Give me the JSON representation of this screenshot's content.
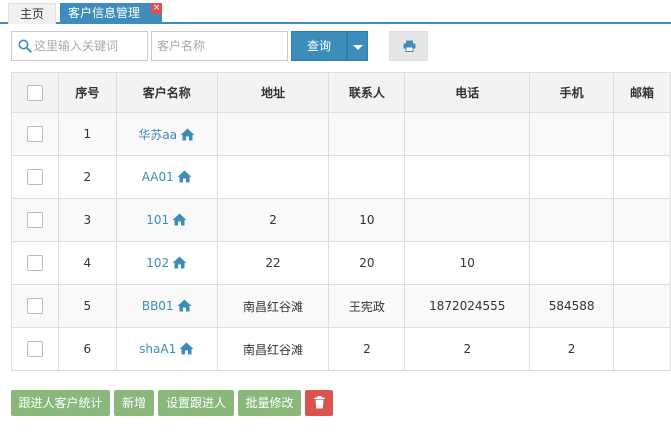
{
  "tabs": {
    "home": "主页",
    "active": "客户信息管理",
    "close": "×"
  },
  "toolbar": {
    "keyword_placeholder": "这里输入关键词",
    "name_placeholder": "客户名称",
    "query_label": "查询"
  },
  "table": {
    "headers": {
      "seq": "序号",
      "name": "客户名称",
      "address": "地址",
      "contact": "联系人",
      "phone": "电话",
      "mobile": "手机",
      "email": "邮箱"
    },
    "rows": [
      {
        "seq": "1",
        "name": "华苏aa",
        "address": "",
        "contact": "",
        "phone": "",
        "mobile": "",
        "email": ""
      },
      {
        "seq": "2",
        "name": "AA01",
        "address": "",
        "contact": "",
        "phone": "",
        "mobile": "",
        "email": ""
      },
      {
        "seq": "3",
        "name": "101",
        "address": "2",
        "contact": "10",
        "phone": "",
        "mobile": "",
        "email": ""
      },
      {
        "seq": "4",
        "name": "102",
        "address": "22",
        "contact": "20",
        "phone": "10",
        "mobile": "",
        "email": ""
      },
      {
        "seq": "5",
        "name": "BB01",
        "address": "南昌红谷滩",
        "contact": "王宪政",
        "phone": "1872024555",
        "mobile": "584588",
        "email": ""
      },
      {
        "seq": "6",
        "name": "shaA1",
        "address": "南昌红谷滩",
        "contact": "2",
        "phone": "2",
        "mobile": "2",
        "email": ""
      }
    ]
  },
  "actions": {
    "stats": "跟进人客户统计",
    "add": "新增",
    "set_follower": "设置跟进人",
    "batch_edit": "批量修改"
  },
  "colors": {
    "primary": "#3c8dbc",
    "green": "#8ab87a",
    "danger": "#d9534f"
  },
  "icons": {
    "search": "search-icon",
    "print": "print-icon",
    "home": "home-icon",
    "trash": "trash-icon"
  }
}
